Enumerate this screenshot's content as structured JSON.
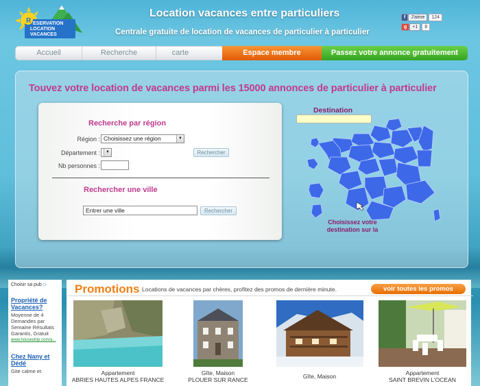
{
  "header": {
    "title": "Location vacances entre particuliers",
    "subtitle": "Centrale gratuite de location de vacances de particulier à particulier",
    "logo": {
      "line1": "ESERVATION",
      "line2": "LOCATION",
      "line3": "VACANCES",
      "badge": "R"
    }
  },
  "social": {
    "facebook_label": "J'aime",
    "facebook_count": "124",
    "gplus_label": "+1",
    "gplus_count": "8"
  },
  "nav": {
    "tabs": [
      {
        "label": "Accueil"
      },
      {
        "label": "Recherche"
      },
      {
        "label": "carte"
      }
    ],
    "espace_label": "Espace membre",
    "passez_label": "Passez votre annonce gratuitement"
  },
  "main": {
    "headline": "Touvez votre location de vacances parmi les 15000 annonces de particulier à particulier",
    "search_region": {
      "heading": "Recherche par région",
      "region_label": "Région :",
      "region_value": "Choisissez une région",
      "departement_label": "Département :",
      "nb_label": "Nb personnes :",
      "search_button": "Rechercher"
    },
    "search_city": {
      "heading": "Rechercher une ville",
      "input_value": "Entrer une ville",
      "search_button": "Rechercher"
    },
    "map": {
      "title": "Destination",
      "caption": "Choisissez votre destination sur la",
      "fill_color": "#3d69e8"
    }
  },
  "ad": {
    "label": "Choisir sa pub",
    "link1": "Propriété de Vacances?",
    "text1": "Moyenne de 4 Demandes par Semaine Résultats Garantis, Gratuit",
    "url1": "www.houseotrip.com/a...",
    "link2": "Chez Nany et Dédé",
    "text2": "Gite calme et"
  },
  "promotions": {
    "title": "Promotions",
    "description": "Locations de vacances par chères, profitez des promos de dernière minute.",
    "button": "voir toutes les promos",
    "cards": [
      {
        "type": "Appartement",
        "place": "ABRIES HAUTES ALPES FRANCE"
      },
      {
        "type": "Gîte, Maison",
        "place": "PLOUER SUR RANCE"
      },
      {
        "type": "Gîte, Maison",
        "place": ""
      },
      {
        "type": "Appartement",
        "place": "SAINT BREVIN L'OCEAN"
      }
    ]
  }
}
